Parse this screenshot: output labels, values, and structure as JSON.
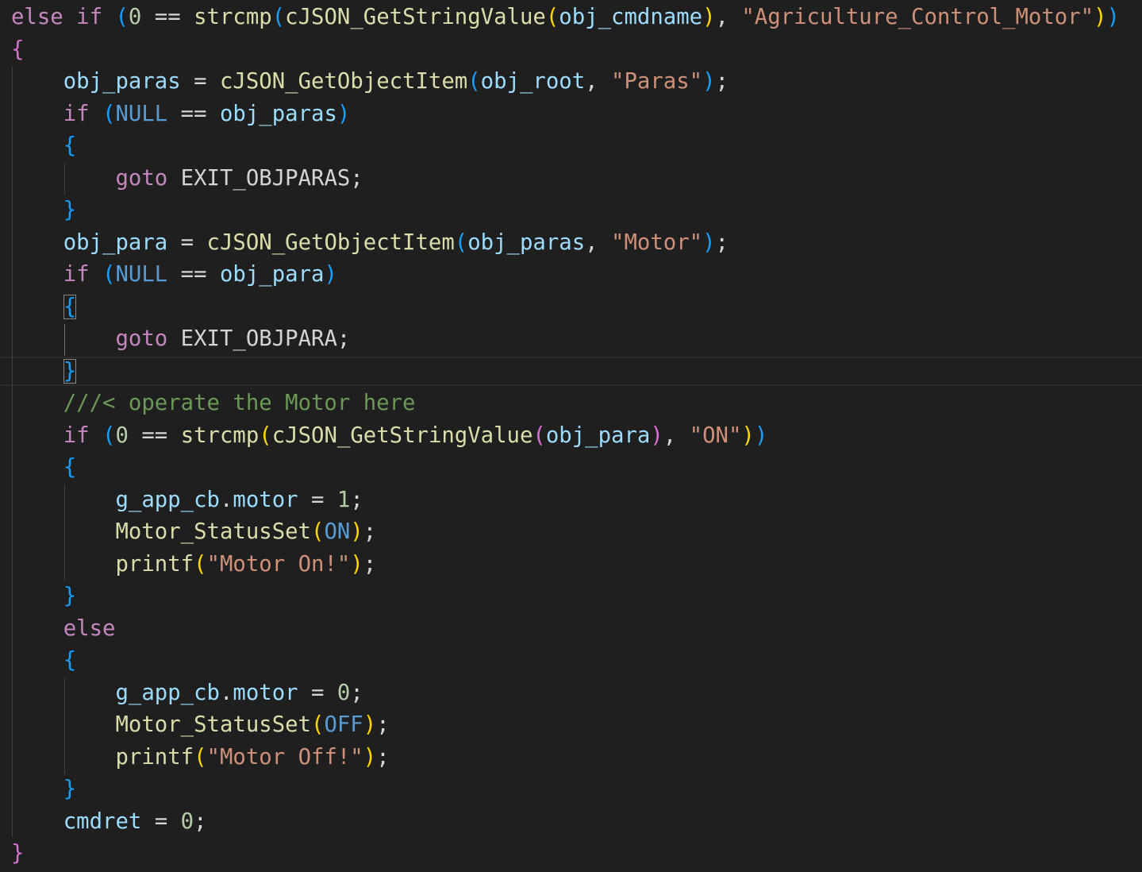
{
  "editor": {
    "language": "c",
    "theme": "dark",
    "colors": {
      "background": "#1f1f1f",
      "keyword": "#569cd6",
      "control": "#c586c0",
      "function": "#dcdcaa",
      "variable": "#9cdcfe",
      "string": "#ce9178",
      "number": "#b5cea8",
      "comment": "#6a9955",
      "bracket_1": "#ffd700",
      "bracket_2": "#da70d6",
      "bracket_3": "#179fff"
    },
    "lines": [
      [
        {
          "t": "else if ",
          "c": "ctl"
        },
        {
          "t": "(",
          "c": "b3"
        },
        {
          "t": "0",
          "c": "num"
        },
        {
          "t": " == ",
          "c": "op"
        },
        {
          "t": "strcmp",
          "c": "fn"
        },
        {
          "t": "(",
          "c": "b3"
        },
        {
          "t": "cJSON_GetStringValue",
          "c": "fn"
        },
        {
          "t": "(",
          "c": "b1"
        },
        {
          "t": "obj_cmdname",
          "c": "var"
        },
        {
          "t": ")",
          "c": "b1"
        },
        {
          "t": ", ",
          "c": "op"
        },
        {
          "t": "\"Agriculture_Control_Motor\"",
          "c": "str"
        },
        {
          "t": ")",
          "c": "b1"
        },
        {
          "t": ")",
          "c": "b3"
        }
      ],
      [
        {
          "t": "{",
          "c": "b2"
        }
      ],
      [
        {
          "t": "    ",
          "c": "op"
        },
        {
          "t": "obj_paras",
          "c": "var"
        },
        {
          "t": " = ",
          "c": "op"
        },
        {
          "t": "cJSON_GetObjectItem",
          "c": "fn"
        },
        {
          "t": "(",
          "c": "b3"
        },
        {
          "t": "obj_root",
          "c": "var"
        },
        {
          "t": ", ",
          "c": "op"
        },
        {
          "t": "\"Paras\"",
          "c": "str"
        },
        {
          "t": ")",
          "c": "b3"
        },
        {
          "t": ";",
          "c": "op"
        }
      ],
      [
        {
          "t": "    ",
          "c": "op"
        },
        {
          "t": "if ",
          "c": "ctl"
        },
        {
          "t": "(",
          "c": "b3"
        },
        {
          "t": "NULL",
          "c": "kw"
        },
        {
          "t": " == ",
          "c": "op"
        },
        {
          "t": "obj_paras",
          "c": "var"
        },
        {
          "t": ")",
          "c": "b3"
        }
      ],
      [
        {
          "t": "    ",
          "c": "op"
        },
        {
          "t": "{",
          "c": "b3"
        }
      ],
      [
        {
          "t": "        ",
          "c": "op"
        },
        {
          "t": "goto",
          "c": "ctl"
        },
        {
          "t": " EXIT_OBJPARAS;",
          "c": "op"
        }
      ],
      [
        {
          "t": "    ",
          "c": "op"
        },
        {
          "t": "}",
          "c": "b3"
        }
      ],
      [
        {
          "t": "    ",
          "c": "op"
        },
        {
          "t": "obj_para",
          "c": "var"
        },
        {
          "t": " = ",
          "c": "op"
        },
        {
          "t": "cJSON_GetObjectItem",
          "c": "fn"
        },
        {
          "t": "(",
          "c": "b3"
        },
        {
          "t": "obj_paras",
          "c": "var"
        },
        {
          "t": ", ",
          "c": "op"
        },
        {
          "t": "\"Motor\"",
          "c": "str"
        },
        {
          "t": ")",
          "c": "b3"
        },
        {
          "t": ";",
          "c": "op"
        }
      ],
      [
        {
          "t": "    ",
          "c": "op"
        },
        {
          "t": "if ",
          "c": "ctl"
        },
        {
          "t": "(",
          "c": "b3"
        },
        {
          "t": "NULL",
          "c": "kw"
        },
        {
          "t": " == ",
          "c": "op"
        },
        {
          "t": "obj_para",
          "c": "var"
        },
        {
          "t": ")",
          "c": "b3"
        }
      ],
      [
        {
          "t": "    ",
          "c": "op"
        },
        {
          "t": "{",
          "c": "b3",
          "box": true
        }
      ],
      [
        {
          "t": "        ",
          "c": "op"
        },
        {
          "t": "goto",
          "c": "ctl"
        },
        {
          "t": " EXIT_OBJPARA;",
          "c": "op"
        }
      ],
      [
        {
          "t": "    ",
          "c": "op"
        },
        {
          "t": "}",
          "c": "b3",
          "box": true
        }
      ],
      [
        {
          "t": "    ",
          "c": "op"
        },
        {
          "t": "///< operate the Motor here",
          "c": "cm"
        }
      ],
      [
        {
          "t": "    ",
          "c": "op"
        },
        {
          "t": "if ",
          "c": "ctl"
        },
        {
          "t": "(",
          "c": "b3"
        },
        {
          "t": "0",
          "c": "num"
        },
        {
          "t": " == ",
          "c": "op"
        },
        {
          "t": "strcmp",
          "c": "fn"
        },
        {
          "t": "(",
          "c": "b1"
        },
        {
          "t": "cJSON_GetStringValue",
          "c": "fn"
        },
        {
          "t": "(",
          "c": "b2"
        },
        {
          "t": "obj_para",
          "c": "var"
        },
        {
          "t": ")",
          "c": "b2"
        },
        {
          "t": ", ",
          "c": "op"
        },
        {
          "t": "\"ON\"",
          "c": "str"
        },
        {
          "t": ")",
          "c": "b1"
        },
        {
          "t": ")",
          "c": "b3"
        }
      ],
      [
        {
          "t": "    ",
          "c": "op"
        },
        {
          "t": "{",
          "c": "b3"
        }
      ],
      [
        {
          "t": "        ",
          "c": "op"
        },
        {
          "t": "g_app_cb",
          "c": "var"
        },
        {
          "t": ".",
          "c": "op"
        },
        {
          "t": "motor",
          "c": "var"
        },
        {
          "t": " = ",
          "c": "op"
        },
        {
          "t": "1",
          "c": "num"
        },
        {
          "t": ";",
          "c": "op"
        }
      ],
      [
        {
          "t": "        ",
          "c": "op"
        },
        {
          "t": "Motor_StatusSet",
          "c": "fn"
        },
        {
          "t": "(",
          "c": "b1"
        },
        {
          "t": "ON",
          "c": "kw"
        },
        {
          "t": ")",
          "c": "b1"
        },
        {
          "t": ";",
          "c": "op"
        }
      ],
      [
        {
          "t": "        ",
          "c": "op"
        },
        {
          "t": "printf",
          "c": "fn"
        },
        {
          "t": "(",
          "c": "b1"
        },
        {
          "t": "\"Motor On!\"",
          "c": "str"
        },
        {
          "t": ")",
          "c": "b1"
        },
        {
          "t": ";",
          "c": "op"
        }
      ],
      [
        {
          "t": "    ",
          "c": "op"
        },
        {
          "t": "}",
          "c": "b3"
        }
      ],
      [
        {
          "t": "    ",
          "c": "op"
        },
        {
          "t": "else",
          "c": "ctl"
        }
      ],
      [
        {
          "t": "    ",
          "c": "op"
        },
        {
          "t": "{",
          "c": "b3"
        }
      ],
      [
        {
          "t": "        ",
          "c": "op"
        },
        {
          "t": "g_app_cb",
          "c": "var"
        },
        {
          "t": ".",
          "c": "op"
        },
        {
          "t": "motor",
          "c": "var"
        },
        {
          "t": " = ",
          "c": "op"
        },
        {
          "t": "0",
          "c": "num"
        },
        {
          "t": ";",
          "c": "op"
        }
      ],
      [
        {
          "t": "        ",
          "c": "op"
        },
        {
          "t": "Motor_StatusSet",
          "c": "fn"
        },
        {
          "t": "(",
          "c": "b1"
        },
        {
          "t": "OFF",
          "c": "kw"
        },
        {
          "t": ")",
          "c": "b1"
        },
        {
          "t": ";",
          "c": "op"
        }
      ],
      [
        {
          "t": "        ",
          "c": "op"
        },
        {
          "t": "printf",
          "c": "fn"
        },
        {
          "t": "(",
          "c": "b1"
        },
        {
          "t": "\"Motor Off!\"",
          "c": "str"
        },
        {
          "t": ")",
          "c": "b1"
        },
        {
          "t": ";",
          "c": "op"
        }
      ],
      [
        {
          "t": "    ",
          "c": "op"
        },
        {
          "t": "}",
          "c": "b3"
        }
      ],
      [
        {
          "t": "    ",
          "c": "op"
        },
        {
          "t": "cmdret",
          "c": "var"
        },
        {
          "t": " = ",
          "c": "op"
        },
        {
          "t": "0",
          "c": "num"
        },
        {
          "t": ";",
          "c": "op"
        }
      ],
      [
        {
          "t": "}",
          "c": "b2"
        }
      ]
    ]
  }
}
